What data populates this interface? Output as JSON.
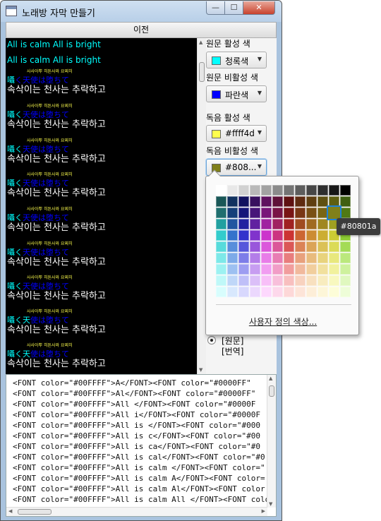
{
  "window": {
    "title": "노래방 자막 만들기",
    "min": "—",
    "max": "☐",
    "close": "✕"
  },
  "toolbar": {
    "prev_label": "이전"
  },
  "preview": {
    "header1": "All is calm All is bright",
    "header2": "All is calm All is bright",
    "ruby": "사사아뿌 히튼사와 요찌히",
    "lyric_line": "囁く天使は堕ちて",
    "translation": "속삭이는 천사는 추락하고"
  },
  "options": {
    "orig_active": {
      "label": "원문 활성 색",
      "value": "청록색",
      "color": "#00ffff"
    },
    "orig_inactive": {
      "label": "원문 비활성 색",
      "value": "파란색",
      "color": "#0000ff"
    },
    "dub_active": {
      "label": "독음 활성 색",
      "value": "#ffff4d",
      "color": "#ffff4d"
    },
    "dub_inactive": {
      "label": "독음 비활성 색",
      "value": "#808...",
      "color": "#80801a"
    },
    "radio": [
      "[원문]",
      "[번역]"
    ]
  },
  "picker": {
    "custom_label": "사용자 정의 색상...",
    "tooltip": "#80801a",
    "selected": "#80801a"
  },
  "code_lines": [
    "<FONT color=\"#00FFFF\">A</FONT><FONT color=\"#0000FF\"",
    "<FONT color=\"#00FFFF\">Al</FONT><FONT color=\"#0000FF\"",
    "<FONT color=\"#00FFFF\">All </FONT><FONT color=\"#0000F",
    "<FONT color=\"#00FFFF\">All i</FONT><FONT color=\"#0000F",
    "<FONT color=\"#00FFFF\">All is </FONT><FONT color=\"#000",
    "<FONT color=\"#00FFFF\">All is c</FONT><FONT color=\"#00",
    "<FONT color=\"#00FFFF\">All is ca</FONT><FONT color=\"#0",
    "<FONT color=\"#00FFFF\">All is cal</FONT><FONT color=\"#0",
    "<FONT color=\"#00FFFF\">All is calm </FONT><FONT color=\"",
    "<FONT color=\"#00FFFF\">All is calm A</FONT><FONT color=",
    "<FONT color=\"#00FFFF\">All is calm Al</FONT><FONT color",
    "<FONT color=\"#00FFFF\">All is calm All </FONT><FONT colo"
  ]
}
